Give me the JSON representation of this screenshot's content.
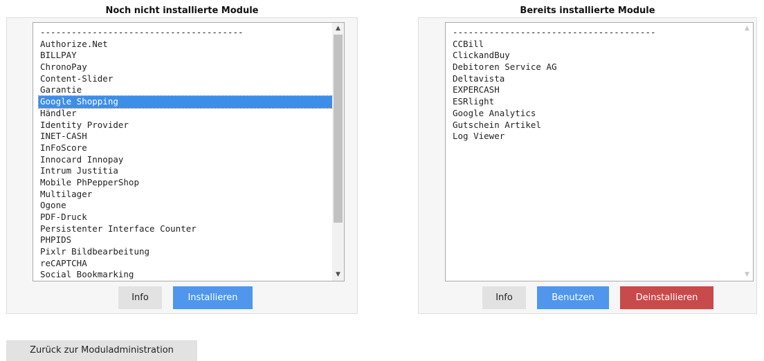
{
  "left_panel": {
    "title": "Noch nicht installierte Module",
    "items": [
      "---------------------------------------",
      "Authorize.Net",
      "BILLPAY",
      "ChronoPay",
      "Content-Slider",
      "Garantie",
      "Google Shopping",
      "Händler",
      "Identity Provider",
      "INET-CASH",
      "InFoScore",
      "Innocard Innopay",
      "Intrum Justitia",
      "Mobile PhPepperShop",
      "Multilager",
      "Ogone",
      "PDF-Druck",
      "Persistenter Interface Counter",
      "PHPIDS",
      "Pixlr Bildbearbeitung",
      "reCAPTCHA",
      "Social Bookmarking"
    ],
    "selected_item": "Google Shopping",
    "buttons": {
      "info": "Info",
      "install": "Installieren"
    }
  },
  "right_panel": {
    "title": "Bereits installierte Module",
    "items": [
      "---------------------------------------",
      "CCBill",
      "ClickandBuy",
      "Debitoren Service AG",
      "Deltavista",
      "EXPERCASH",
      "ESRlight",
      "Google Analytics",
      "Gutschein Artikel",
      "Log Viewer"
    ],
    "buttons": {
      "info": "Info",
      "use": "Benutzen",
      "uninstall": "Deinstallieren"
    }
  },
  "back_button": "Zurück zur Moduladministration",
  "colors": {
    "selection": "#3d8ee9",
    "primary_button": "#4f96ec",
    "danger_button": "#c84a4a",
    "neutral_button": "#e2e2e2"
  },
  "icons": {
    "scroll_up": "chevron-up-icon",
    "scroll_down": "chevron-down-icon"
  }
}
